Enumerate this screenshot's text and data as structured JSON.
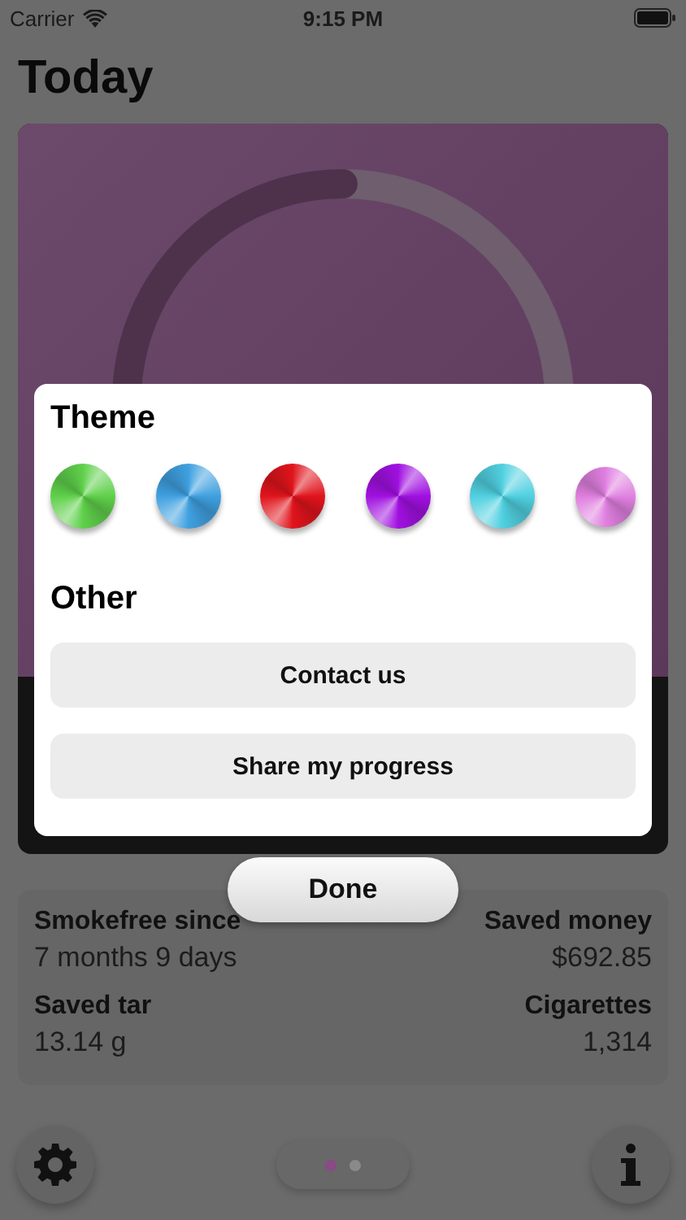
{
  "status_bar": {
    "carrier": "Carrier",
    "time": "9:15 PM"
  },
  "title": "Today",
  "settings_sheet": {
    "theme_heading": "Theme",
    "themes": [
      {
        "color": "#5fd04a"
      },
      {
        "color": "#3fa0e0"
      },
      {
        "color": "#e0141c"
      },
      {
        "color": "#a010e0"
      },
      {
        "color": "#50d0e0"
      },
      {
        "color": "#e080e0"
      }
    ],
    "other_heading": "Other",
    "buttons": [
      "Contact us",
      "Share my progress"
    ]
  },
  "done_button": "Done",
  "stats": [
    {
      "label": "Smokefree since",
      "value": "7 months 9 days"
    },
    {
      "label": "Saved money",
      "value": "$692.85"
    },
    {
      "label": "Saved tar",
      "value": "13.14 g"
    },
    {
      "label": "Cigarettes",
      "value": "1,314"
    }
  ],
  "page_dots": [
    {
      "selected": true
    },
    {
      "selected": false
    }
  ]
}
